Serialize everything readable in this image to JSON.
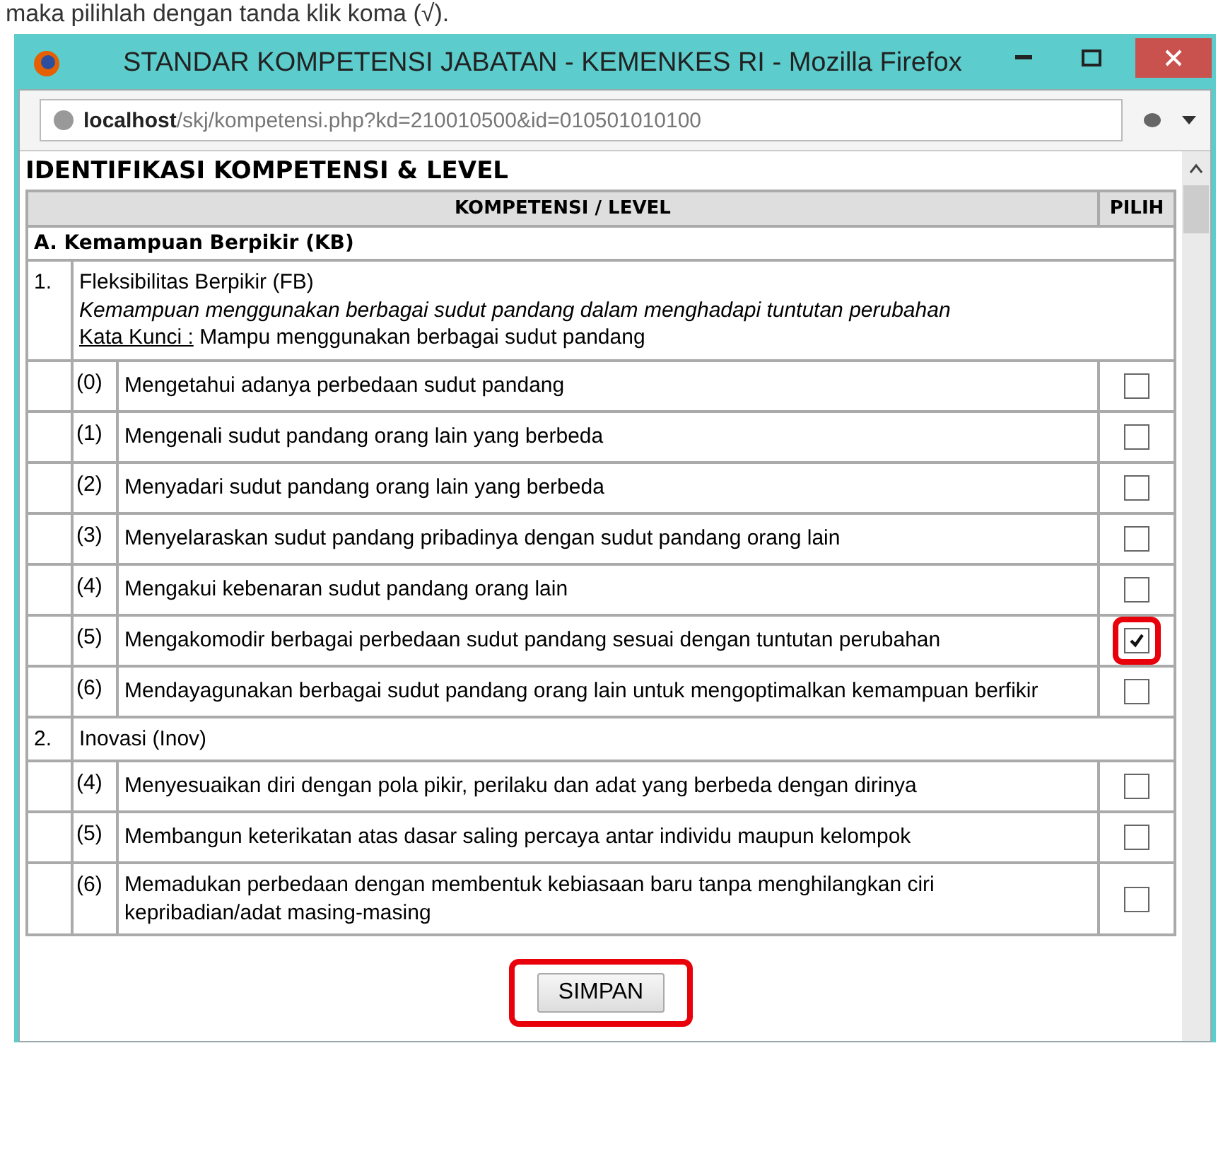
{
  "caption": "maka pilihlah dengan tanda klik koma (√).",
  "window": {
    "title": "STANDAR KOMPETENSI JABATAN - KEMENKES RI - Mozilla Firefox",
    "url_host": "localhost",
    "url_path": "/skj/kompetensi.php?kd=210010500&id=010501010100"
  },
  "section_title": "IDENTIFIKASI KOMPETENSI & LEVEL",
  "table": {
    "columns": [
      "KOMPETENSI / LEVEL",
      "PILIH"
    ],
    "groups": [
      {
        "label": "A. Kemampuan Berpikir (KB)",
        "competencies": [
          {
            "number": "1.",
            "name": "Fleksibilitas Berpikir (FB)",
            "description": "Kemampuan menggunakan berbagai sudut pandang dalam menghadapi tuntutan perubahan",
            "keyword_label": "Kata Kunci :",
            "keyword": "Mampu menggunakan berbagai sudut pandang",
            "levels": [
              {
                "level": "(0)",
                "text": "Mengetahui adanya perbedaan sudut pandang",
                "checked": false,
                "highlighted": false
              },
              {
                "level": "(1)",
                "text": "Mengenali sudut pandang orang lain yang berbeda",
                "checked": false,
                "highlighted": false
              },
              {
                "level": "(2)",
                "text": "Menyadari sudut pandang orang lain yang berbeda",
                "checked": false,
                "highlighted": false
              },
              {
                "level": "(3)",
                "text": "Menyelaraskan sudut pandang pribadinya dengan sudut pandang orang lain",
                "checked": false,
                "highlighted": false
              },
              {
                "level": "(4)",
                "text": "Mengakui kebenaran sudut pandang orang lain",
                "checked": false,
                "highlighted": false
              },
              {
                "level": "(5)",
                "text": "Mengakomodir berbagai perbedaan sudut pandang sesuai dengan tuntutan perubahan",
                "checked": true,
                "highlighted": true
              },
              {
                "level": "(6)",
                "text": "Mendayagunakan berbagai sudut pandang orang lain untuk mengoptimalkan kemampuan berfikir",
                "checked": false,
                "highlighted": false
              }
            ]
          },
          {
            "number": "2.",
            "name": "Inovasi (Inov)",
            "levels": [
              {
                "level": "(4)",
                "text": "Menyesuaikan diri dengan pola pikir, perilaku dan adat yang berbeda dengan dirinya",
                "checked": false,
                "highlighted": false
              },
              {
                "level": "(5)",
                "text": "Membangun keterikatan atas dasar saling percaya antar individu maupun kelompok",
                "checked": false,
                "highlighted": false
              },
              {
                "level": "(6)",
                "text": "Memadukan perbedaan dengan membentuk kebiasaan baru tanpa menghilangkan ciri kepribadian/adat masing-masing",
                "checked": false,
                "highlighted": false
              }
            ]
          }
        ]
      }
    ]
  },
  "button": {
    "label": "SIMPAN",
    "highlighted": true
  }
}
